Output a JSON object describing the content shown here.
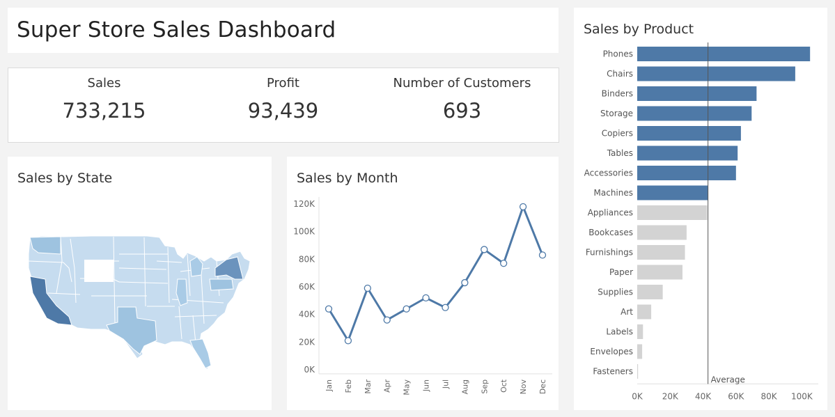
{
  "dashboard": {
    "title": "Super Store Sales Dashboard"
  },
  "kpis": [
    {
      "label": "Sales",
      "value": "733,215"
    },
    {
      "label": "Profit",
      "value": "93,439"
    },
    {
      "label": "Number of Customers",
      "value": "693"
    }
  ],
  "colors": {
    "bar_above_average": "#4e79a7",
    "bar_below_average": "#d3d3d3",
    "line": "#4e79a7",
    "map_dark": "#4e79a7",
    "map_light": "#c6dcef",
    "background": "#f3f3f3"
  },
  "map": {
    "title": "Sales by State",
    "highlighted_states": [
      "California",
      "New York",
      "Texas",
      "Washington",
      "Pennsylvania",
      "Florida"
    ]
  },
  "chart_data": [
    {
      "type": "line",
      "title": "Sales by Month",
      "categories": [
        "Jan",
        "Feb",
        "Mar",
        "Apr",
        "May",
        "Jun",
        "Jul",
        "Aug",
        "Sep",
        "Oct",
        "Nov",
        "Dec"
      ],
      "values": [
        44000,
        21000,
        59000,
        36000,
        44000,
        52000,
        45000,
        63000,
        87000,
        77000,
        118000,
        83000
      ],
      "ylim": [
        0,
        120000
      ],
      "yticks": [
        0,
        20000,
        40000,
        60000,
        80000,
        100000,
        120000
      ],
      "ytick_labels": [
        "0K",
        "20K",
        "40K",
        "60K",
        "80K",
        "100K",
        "120K"
      ],
      "markers": true,
      "grid": false
    },
    {
      "type": "bar",
      "orientation": "horizontal",
      "title": "Sales by Product",
      "categories": [
        "Phones",
        "Chairs",
        "Binders",
        "Storage",
        "Copiers",
        "Tables",
        "Accessories",
        "Machines",
        "Appliances",
        "Bookcases",
        "Furnishings",
        "Paper",
        "Supplies",
        "Art",
        "Labels",
        "Envelopes",
        "Fasteners"
      ],
      "values": [
        105000,
        96000,
        72500,
        69500,
        63000,
        61000,
        60000,
        43000,
        42500,
        30000,
        29000,
        27500,
        15500,
        8500,
        3500,
        3000,
        500
      ],
      "reference_line": {
        "label": "Average",
        "value": 43000
      },
      "xlim": [
        0,
        110000
      ],
      "xticks": [
        0,
        20000,
        40000,
        60000,
        80000,
        100000
      ],
      "xtick_labels": [
        "0K",
        "20K",
        "40K",
        "60K",
        "80K",
        "100K"
      ],
      "grid": false
    }
  ]
}
